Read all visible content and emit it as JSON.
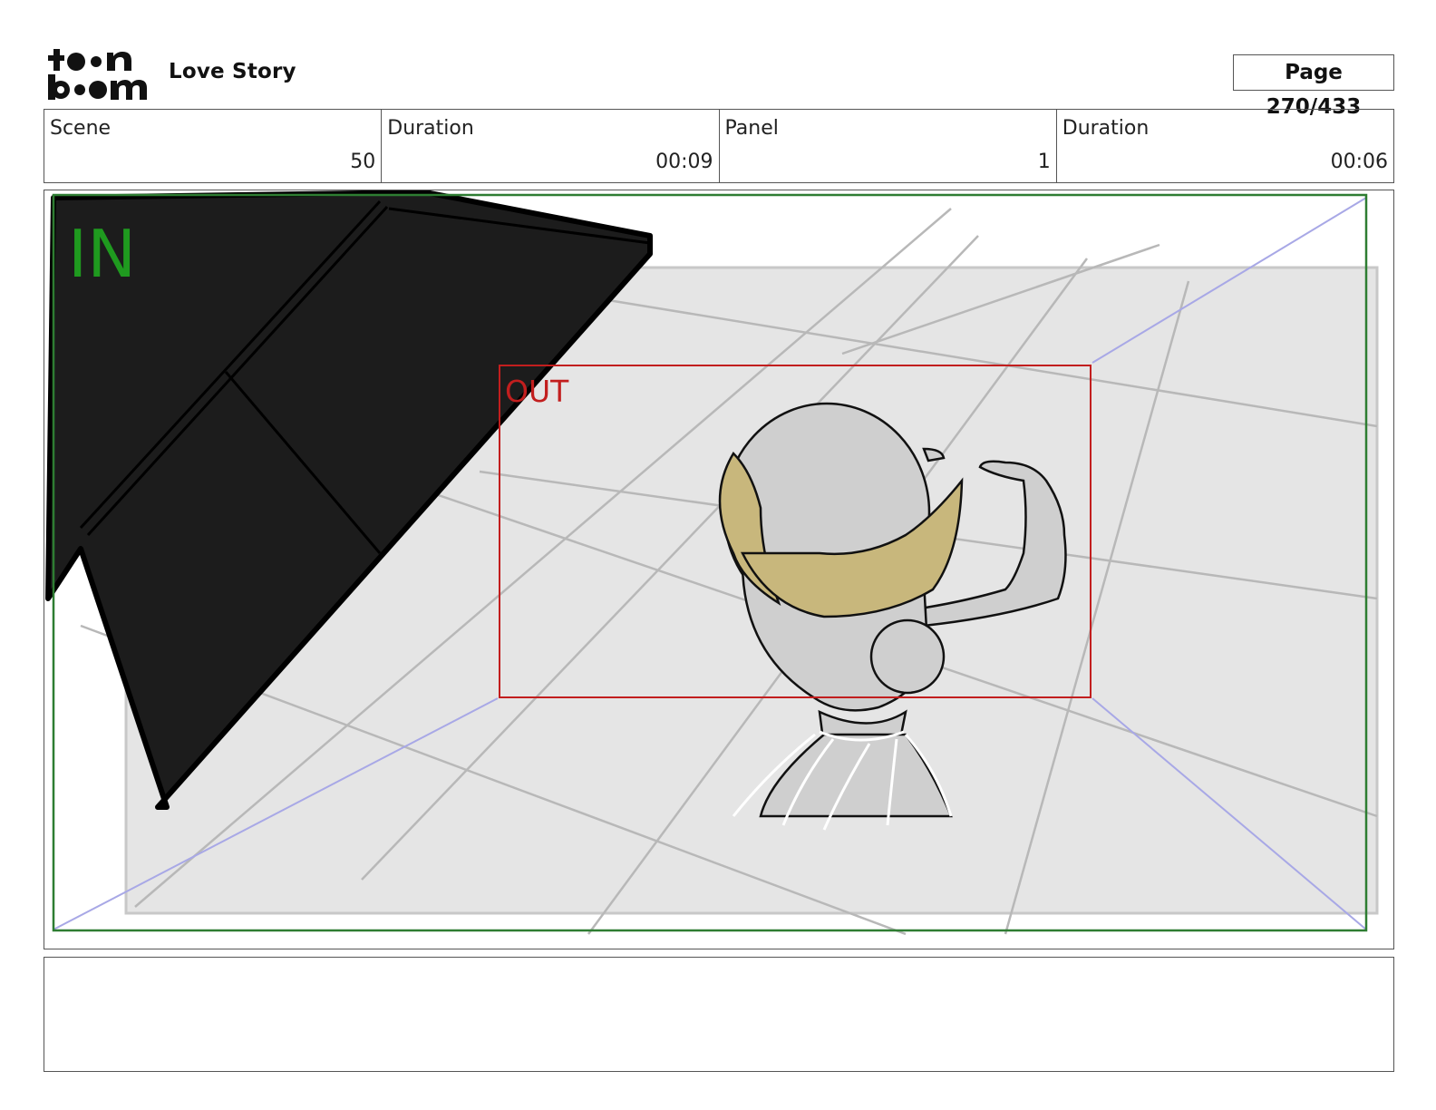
{
  "header": {
    "logo": {
      "top": "to•n",
      "bottom": "b••m"
    },
    "project_title": "Love Story",
    "page_label": "Page 270/433"
  },
  "info": {
    "scene_label": "Scene",
    "scene_value": "50",
    "scene_duration_label": "Duration",
    "scene_duration_value": "00:09",
    "panel_label": "Panel",
    "panel_value": "1",
    "panel_duration_label": "Duration",
    "panel_duration_value": "00:06"
  },
  "frame": {
    "in_label": "IN",
    "out_label": "OUT",
    "in_color": "#1f9a1f",
    "out_color": "#c21e1e"
  },
  "notes": {
    "text": ""
  }
}
